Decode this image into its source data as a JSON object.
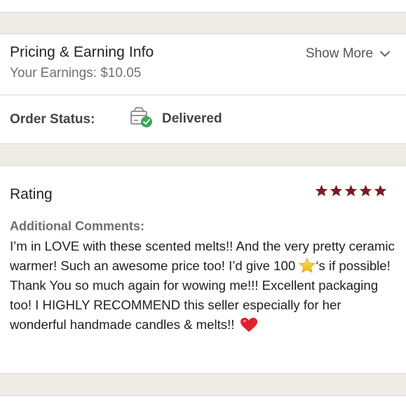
{
  "pricing": {
    "title": "Pricing & Earning Info",
    "earnings": "Your Earnings: $10.05",
    "show_more": "Show More"
  },
  "order": {
    "label": "Order Status:",
    "value": "Delivered",
    "icon": "package-delivered-icon"
  },
  "rating": {
    "title": "Rating",
    "stars": 5,
    "star_color": "#7a1c24",
    "comments_label": "Additional Comments:",
    "comment_part1": "I’m in LOVE with these scented melts!! And the very pretty ceramic warmer! Such an awesome price too! I’d give 100 ",
    "comment_part2": "‘s if possible! Thank You so much again for wowing me!!! Excellent packaging too! I HIGHLY RECOMMEND this seller especially for her wonderful handmade candles & melts!! ",
    "comment_emoji_1": "star-emoji",
    "comment_emoji_2": "red-heart-emoji"
  },
  "colors": {
    "background": "#efece6",
    "card": "#ffffff",
    "delivered_check": "#3aa655"
  }
}
